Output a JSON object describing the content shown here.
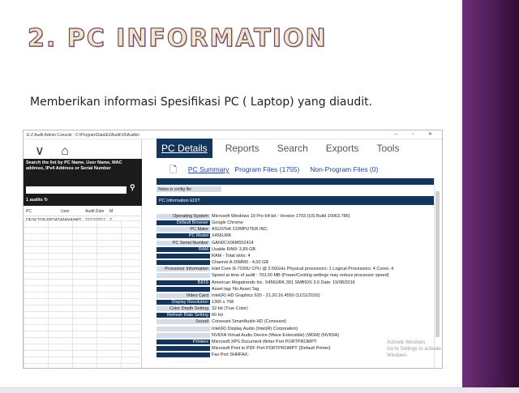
{
  "slide": {
    "title": "2. PC INFORMATION",
    "subtitle": "Memberikan informasi Spesifikasi PC ( Laptop) yang diaudit."
  },
  "window": {
    "title": "E-Z Audit Admin Console - C:\\ProgramData\\EZAudit\\15\\Audits\\",
    "controls": "– ▫ ✕"
  },
  "left": {
    "back": "∨",
    "home": "⌂",
    "search_label": "Search the list by PC Name, User Name, MAC address, IPv4 Address or Serial Number",
    "audits": "1 audits",
    "headers": [
      "PC",
      "User",
      "Audit Date",
      "M"
    ],
    "rows": [
      [
        "DESKTOP-PRSAT4C",
        "MANAHATI",
        "27/12/2017",
        "?"
      ]
    ]
  },
  "tabs": [
    {
      "label": "PC Details",
      "active": true
    },
    {
      "label": "Reports"
    },
    {
      "label": "Search"
    },
    {
      "label": "Exports"
    },
    {
      "label": "Tools"
    }
  ],
  "links": [
    "PC Summary",
    "Program Files (1755)",
    "Non-Program Files (0)"
  ],
  "detail": {
    "notes": "Notes in config file",
    "header": "PC Information  EDIT",
    "rows": [
      {
        "k": "Operating System",
        "v": "Microsoft Windows 10 Pro 64-bit - Version 1703 (OS Build 15063.786)",
        "style": "light"
      },
      {
        "k": "Default Browser",
        "v": "Google Chrome",
        "style": "dark"
      },
      {
        "k": "PC Make",
        "v": "ASUSTeK COMPUTER INC.",
        "style": "light"
      },
      {
        "k": "PC Model",
        "v": "X456URK",
        "style": "dark"
      },
      {
        "k": "PC Serial Number",
        "v": "GAN0CX06M552414",
        "style": "light"
      },
      {
        "k": "RAM",
        "v": "Usable RAM: 3,89 GB",
        "style": "dark"
      },
      {
        "k": "",
        "v": "RAM - Total slots: 4",
        "style": "dark"
      },
      {
        "k": "",
        "v": "Channel A-DIMM0 - 4,00 GB",
        "style": "dark"
      },
      {
        "k": "Processor Information",
        "v": "Intel Core i5-7200U CPU @ 2.50GHz Physical processors: 1 Logical Processors: 4 Cores: 4",
        "style": "light"
      },
      {
        "k": "",
        "v": "Speed at time of audit : 703,00 MB  (Power/Cooling settings may reduce processor speed)",
        "style": "light"
      },
      {
        "k": "BIOS",
        "v": "American Megatrends Inc. X456URK.301 SMBIOS 3.0 Date: 15/08/2016",
        "style": "dark"
      },
      {
        "k": "",
        "v": "Asset tag: No Asset Tag",
        "style": "dark"
      },
      {
        "k": "Video Card",
        "v": "Intel(R) HD Graphics 620 - 21.20.16.4550 (11/11/2016)",
        "style": "light"
      },
      {
        "k": "Display Resolution",
        "v": "1366 x 768",
        "style": "dark"
      },
      {
        "k": "Color Depth Setting",
        "v": "32-bit (True Color)",
        "style": "light"
      },
      {
        "k": "Refresh Rate Setting",
        "v": "60 Hz",
        "style": "dark"
      },
      {
        "k": "Sound",
        "v": "Conexant SmartAudio HD (Conexant)",
        "style": "light"
      },
      {
        "k": "",
        "v": "Intel(R) Display Audio (Intel(R) Corporation)",
        "style": "light"
      },
      {
        "k": "",
        "v": "NVIDIA Virtual Audio Device (Wave Extensible) (WDM) (NVIDIA)",
        "style": "light"
      },
      {
        "k": "Printers",
        "v": "Microsoft XPS Document Writer Port PORTPROMPT:",
        "style": "dark"
      },
      {
        "k": "",
        "v": "Microsoft Print to PDF Port PORTPROMPT: [Default Printer]",
        "style": "dark"
      },
      {
        "k": "",
        "v": "Fax Port SHRFAX:",
        "style": "dark"
      }
    ]
  },
  "watermark": {
    "line1": "Activate Windows",
    "line2": "Go to Settings to activate Windows."
  }
}
